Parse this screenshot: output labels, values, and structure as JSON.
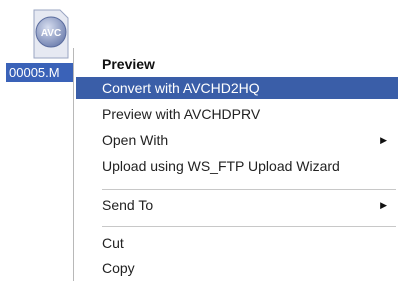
{
  "desktop": {
    "file_icon": {
      "icon": "avc-video-file-icon",
      "badge_text": "AVC"
    },
    "file_label": "00005.M"
  },
  "context_menu": {
    "items": [
      {
        "label": "Preview",
        "bold": true
      },
      {
        "label": "Convert with AVCHD2HQ",
        "highlighted": true
      },
      {
        "label": "Preview with AVCHDPRV"
      },
      {
        "label": "Open With",
        "submenu": true
      },
      {
        "label": "Upload using WS_FTP Upload Wizard"
      },
      {
        "label": "Send To",
        "submenu": true
      },
      {
        "label": "Cut"
      },
      {
        "label": "Copy"
      }
    ],
    "colors": {
      "highlight": "#3a5ea8",
      "highlight_text": "#ffffff",
      "text": "#222222"
    }
  }
}
